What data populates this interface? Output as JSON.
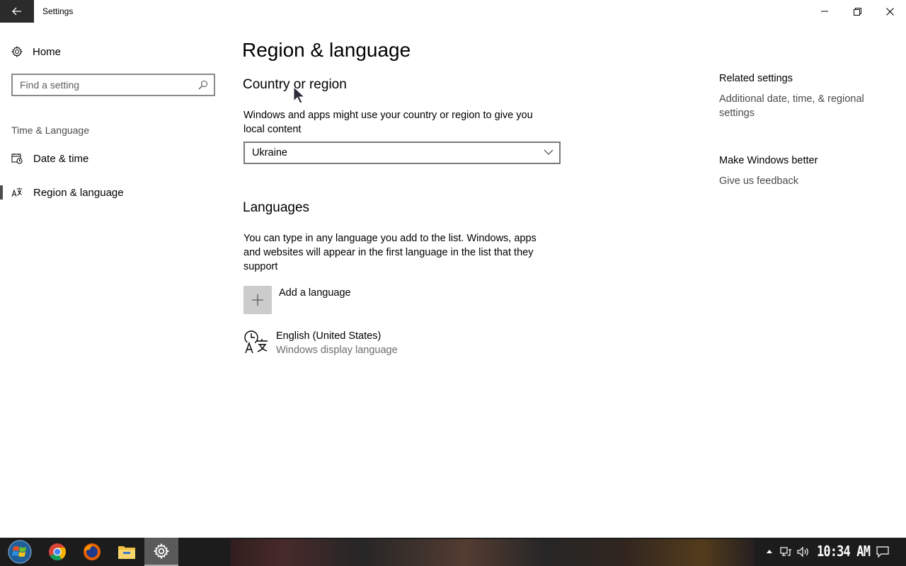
{
  "titlebar": {
    "title": "Settings"
  },
  "sidebar": {
    "home_label": "Home",
    "search_placeholder": "Find a setting",
    "section_label": "Time & Language",
    "items": [
      {
        "label": "Date & time",
        "selected": false
      },
      {
        "label": "Region & language",
        "selected": true
      }
    ]
  },
  "main": {
    "title": "Region & language",
    "country": {
      "heading": "Country or region",
      "description": "Windows and apps might use your country or region to give you local content",
      "selected_value": "Ukraine"
    },
    "languages": {
      "heading": "Languages",
      "description": "You can type in any language you add to the list. Windows, apps and websites will appear in the first language in the list that they support",
      "add_label": "Add a language",
      "items": [
        {
          "name": "English (United States)",
          "sub": "Windows display language"
        }
      ]
    }
  },
  "related": {
    "heading": "Related settings",
    "link": "Additional date, time, & regional settings",
    "feedback_heading": "Make Windows better",
    "feedback_link": "Give us feedback"
  },
  "taskbar": {
    "clock": "10:34 AM",
    "pinned": [
      "start-icon",
      "chrome-icon",
      "firefox-icon",
      "file-explorer-icon",
      "settings-icon"
    ]
  },
  "colors": {
    "titlebar_back_bg": "#2b2b2b",
    "taskbar_bg": "#1c1c1c",
    "add_button_bg": "#cccccc",
    "selected_marker": "#4c4c4c"
  }
}
